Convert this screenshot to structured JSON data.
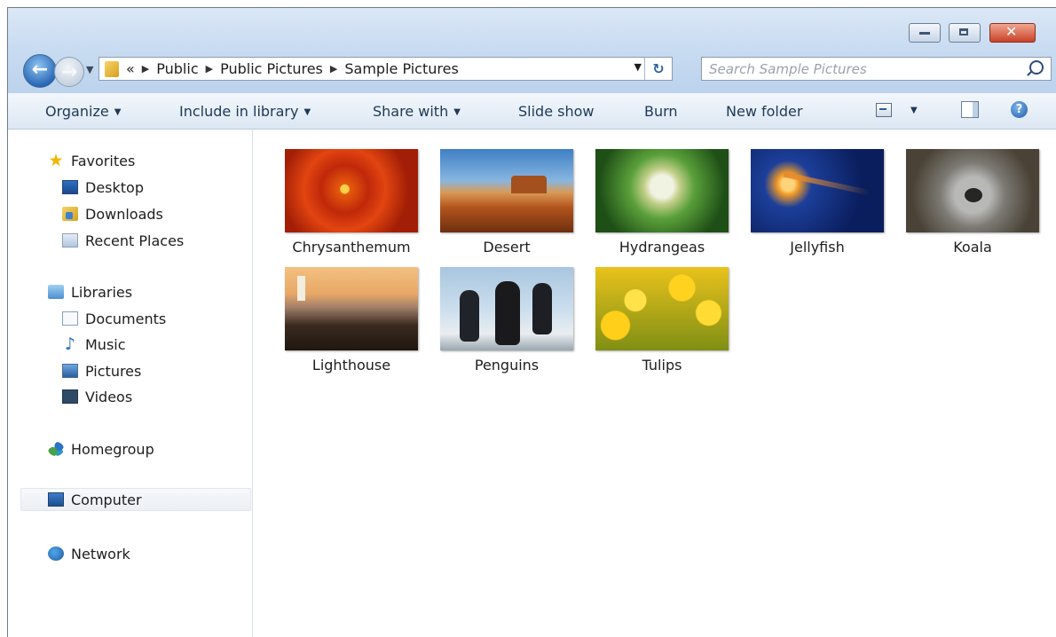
{
  "window": {
    "caption_buttons": {
      "minimize": "minimize-icon",
      "maximize": "maximize-icon",
      "close": "close-icon"
    },
    "close_color": "#c94228"
  },
  "navigation": {
    "back_icon": "back-arrow-icon",
    "forward_icon": "forward-arrow-icon",
    "address": {
      "overflow": "«",
      "crumbs": [
        "Public",
        "Public Pictures",
        "Sample Pictures"
      ]
    },
    "refresh_icon": "refresh-icon",
    "search": {
      "placeholder": "Search Sample Pictures"
    }
  },
  "toolbar": {
    "organize": "Organize",
    "include_in_library": "Include in library",
    "share_with": "Share with",
    "slide_show": "Slide show",
    "burn": "Burn",
    "new_folder": "New folder",
    "help": "?"
  },
  "nav_pane": {
    "favorites": {
      "label": "Favorites",
      "items": [
        "Desktop",
        "Downloads",
        "Recent Places"
      ]
    },
    "libraries": {
      "label": "Libraries",
      "items": [
        "Documents",
        "Music",
        "Pictures",
        "Videos"
      ]
    },
    "homegroup": "Homegroup",
    "computer": "Computer",
    "network": "Network",
    "selected": "Computer"
  },
  "files": [
    {
      "name": "Chrysanthemum"
    },
    {
      "name": "Desert"
    },
    {
      "name": "Hydrangeas"
    },
    {
      "name": "Jellyfish"
    },
    {
      "name": "Koala"
    },
    {
      "name": "Lighthouse"
    },
    {
      "name": "Penguins"
    },
    {
      "name": "Tulips"
    }
  ],
  "colors": {
    "accent": "#2b69b6",
    "toolbar_text": "#1e3957"
  }
}
